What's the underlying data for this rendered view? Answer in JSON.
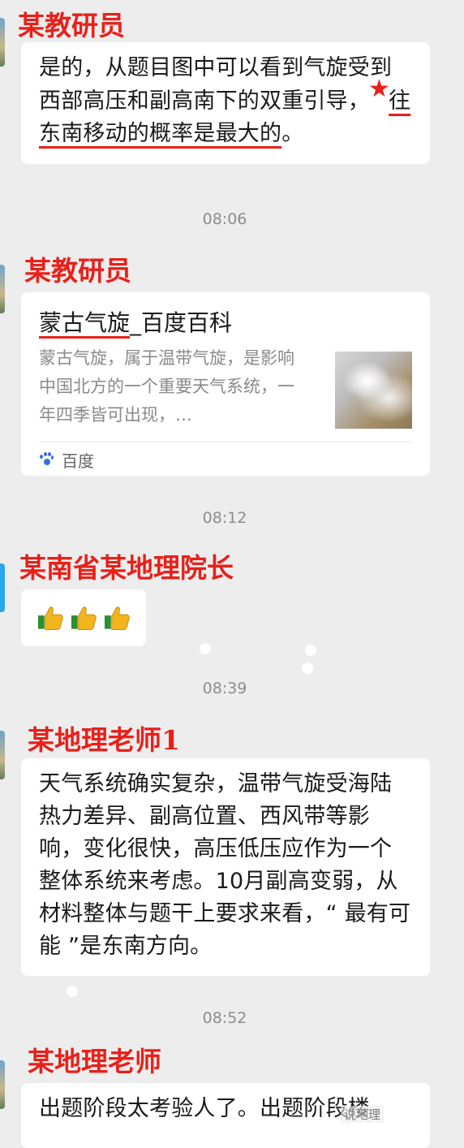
{
  "messages": [
    {
      "sender": "某教研员",
      "text_part1": "是的，从题目图中可以看到气旋受到西部高压和副高南下的双重引导，",
      "star": "★",
      "text_part2": "往东南移动的概率是最大的",
      "text_part3": "。"
    },
    {
      "time": "08:06",
      "sender": "某教研员",
      "card": {
        "title_underlined": "蒙古气旋",
        "title_rest": "_百度百科",
        "description": "蒙古气旋，属于温带气旋，是影响中国北方的一个重要天气系统，一年四季皆可出现，…",
        "source": "百度",
        "thumbnail_icon": "cyclone-satellite-image"
      }
    },
    {
      "time": "08:12",
      "sender": "某南省某地理院长",
      "reactions": [
        "thumbs-up-icon",
        "thumbs-up-icon",
        "thumbs-up-icon"
      ]
    },
    {
      "time": "08:39",
      "sender": "某地理老师1",
      "text": "天气系统确实复杂，温带气旋受海陆热力差异、副高位置、西风带等影响，变化很快，高压低压应作为一个整体系统来考虑。10月副高变弱，从材料整体与题干上要求来看，“ 最有可能 ”是东南方向。"
    },
    {
      "time": "08:52",
      "sender": "某地理老师",
      "text": "出题阶段太考验人了。出题阶段楼"
    }
  ],
  "watermark": "说地理",
  "colors": {
    "background": "#ededed",
    "bubble": "#ffffff",
    "sender_red": "#e8201a",
    "timestamp": "#8d8d8d",
    "baidu_blue": "#3b6de0"
  }
}
